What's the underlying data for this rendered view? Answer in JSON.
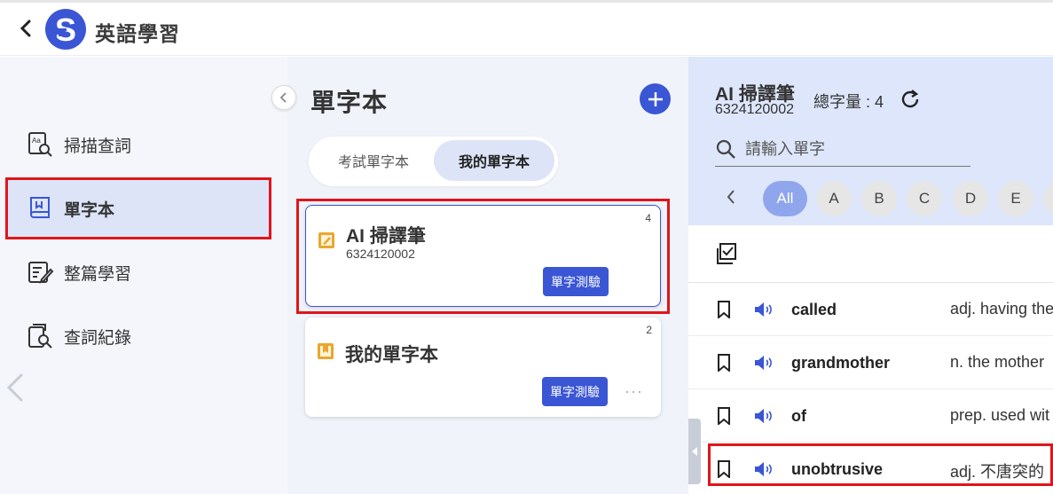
{
  "app": {
    "title": "英語學習",
    "logo_letter": "S"
  },
  "sidebar": {
    "items": [
      {
        "label": "掃描查詞",
        "icon": "scan-book-icon"
      },
      {
        "label": "單字本",
        "icon": "wordbook-icon",
        "active": true
      },
      {
        "label": "整篇學習",
        "icon": "edit-document-icon"
      },
      {
        "label": "查詞紀錄",
        "icon": "history-search-icon"
      }
    ]
  },
  "middle": {
    "title": "單字本",
    "tabs": [
      {
        "label": "考試單字本"
      },
      {
        "label": "我的單字本",
        "active": true
      }
    ],
    "cards": [
      {
        "title": "AI 掃譯筆",
        "subtitle": "6324120002",
        "count": "4",
        "quiz_label": "單字測驗",
        "selected": true
      },
      {
        "title": "我的單字本",
        "subtitle": "",
        "count": "2",
        "quiz_label": "單字測驗",
        "more": "···"
      }
    ]
  },
  "right": {
    "book_title": "AI 掃譯筆",
    "book_id": "6324120002",
    "word_total": "總字量 : 4",
    "search": {
      "placeholder": "請輸入單字"
    },
    "alphabet": [
      "All",
      "A",
      "B",
      "C",
      "D",
      "E"
    ],
    "words": [
      {
        "word": "called",
        "definition": "adj. having the"
      },
      {
        "word": "grandmother",
        "definition": "n. the mother"
      },
      {
        "word": "of",
        "definition": "prep. used wit"
      },
      {
        "word": "unobtrusive",
        "definition": "adj. 不唐突的"
      }
    ]
  },
  "colors": {
    "accent": "#3a56d4",
    "highlight": "#e0151b",
    "active_bg": "#dde4f8",
    "note_icon": "#e8a730"
  }
}
